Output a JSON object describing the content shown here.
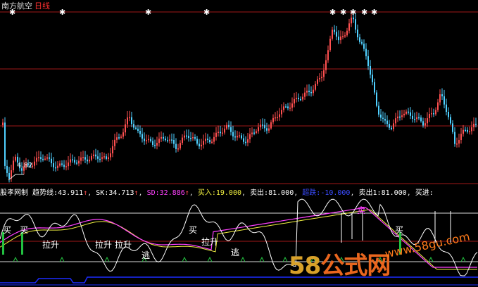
{
  "header": {
    "stock_name": "南方航空",
    "period": "日线"
  },
  "indicator_bar": {
    "name": "股孝网制",
    "trend_label": "趋势线:",
    "trend_value": "43.911",
    "sk_label": "SK:",
    "sk_value": "34.713",
    "sd_label": "SD:",
    "sd_value": "32.886",
    "buy_label": "买入:",
    "buy_value": "19.000",
    "sell_label": "卖出:",
    "sell_value": "81.000",
    "low_label": "超跌:",
    "low_value": "-10.000",
    "sell1_label": "卖出1:",
    "sell1_value": "81.000",
    "buyin_label": "买进:",
    "up_arrow": "↑",
    "sep": ","
  },
  "price_panel": {
    "low_label": "4.82"
  },
  "signals": {
    "buy": "买",
    "pull_up": "拉升",
    "escape": "逃",
    "sell": "卖"
  },
  "watermark": {
    "brand_num": "58",
    "brand_text": "公式网",
    "url": "www.58gu.com"
  },
  "colors": {
    "up": "#ff5050",
    "down": "#50d0ff",
    "trend": "#ffffff",
    "sk": "#ff40ff",
    "sd": "#f0f040",
    "gridline": "#a01818"
  }
}
